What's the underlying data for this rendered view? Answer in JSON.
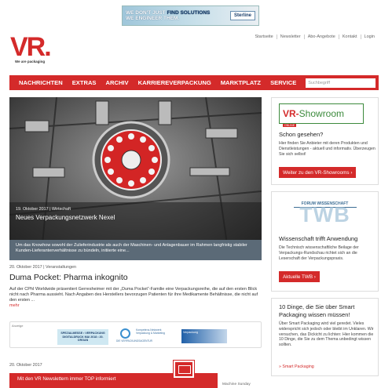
{
  "banner": {
    "line1": "WE DON'T JUST",
    "line1_bold": "FIND SOLUTIONS",
    "line2": "WE ENGINEER THEM.",
    "logo": "Sterline"
  },
  "top_links": [
    "Startseite",
    "Newsletter",
    "Abo-Angebote",
    "Kontakt",
    "Login"
  ],
  "logo": {
    "text": "VR.",
    "tagline": "We are packaging"
  },
  "nav": {
    "items": [
      "NACHRICHTEN",
      "EXTRAS",
      "ARCHIV",
      "KARRIEREVERPACKUNG",
      "MARKTPLATZ",
      "SERVICE"
    ],
    "search_placeholder": "Suchbegriff"
  },
  "hero": {
    "meta": "19. Oktober 2017 | Wirtschaft",
    "title": "Neues Verpackungsnetzwerk Nexel",
    "description": "Um das Knowhow sowohl der Zulieferindustrie als auch der Maschinen- und Anlagenbauer im Rahmen langfristig stabiler Kunden-Lieferantenverhältnisse zu bündeln, initiierte eine..."
  },
  "article": {
    "meta": "20. Oktober 2017 | Veranstaltungen",
    "title": "Duma Pocket: Pharma inkognito",
    "description": "Auf der CPhI Worldwide präsentiert Gerresheimer mit der „Duma Pocket“-Familie eine Verpackungsreihe, die auf den ersten Blick nicht nach Pharma aussieht. Nach Angaben des Herstellers bevorzugen Patienten für ihre Medikamente Behältnisse, die nicht auf den ersten ...",
    "more": "mehr"
  },
  "sponsors": {
    "label": "Anzeige",
    "s1": "SPEZIALMESSE • VERPACKUNG DIGITALDRUCK MAI 2018 • 20. ORGAN",
    "s2": "DIE VERPACKUNGSAGENTUR",
    "s3": "Kompetenz-Netzwerk Verpackung & Marketing",
    "s4": "Verpackung"
  },
  "date2": "20. Oktober 2017",
  "newsletter": {
    "text": "Mit den VR Newslettern immer TOP informiert",
    "side": "Machine Sunday"
  },
  "sidebar": {
    "showroom": {
      "logo_vr": "VR-",
      "logo_text": "Showroom",
      "logo_sub": "ONLINE",
      "heading": "Schon gesehen?",
      "text": "Hier finden Sie Anbieter mit deren Produkten und Dienstleistungen - aktuell und informativ. Überzeugen Sie sich selbst!",
      "button": "Weiter zu den VR-Showrooms ›"
    },
    "twb": {
      "top": "FORUM WISSENSCHAFT",
      "logo": "TWB",
      "heading": "Wissenschaft trifft Anwendung",
      "text": "Die Technisch wissenschaftliche Beilage der Verpackungs-Rundschau richtet sich an die Leserschaft der Verpackungspraxis.",
      "button": "Aktuelle TWB ›"
    },
    "smart": {
      "heading": "10 Dinge, die Sie über Smart Packaging wissen müssen!",
      "text": "Über Smart Packaging wird viel geredet. Vieles widerspricht sich jedoch oder bleibt im Unklaren. Wir versuchen, das Dickicht zu lichten: Hier kommen die 10 Dinge, die Sie zu dem Thema unbedingt wissen sollten.",
      "link": "» Smart Packaging"
    }
  },
  "colors": {
    "brand_red": "#d42a2a",
    "twb_blue": "#3c6d94",
    "showroom_green": "#3c8a3c"
  }
}
